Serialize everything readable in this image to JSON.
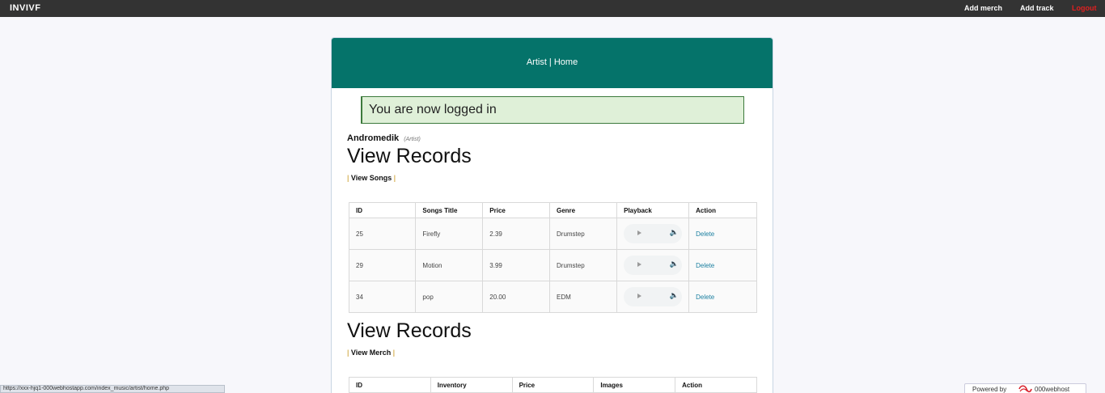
{
  "nav": {
    "brand": "INVIVF",
    "links": [
      "Add merch",
      "Add track",
      "Logout"
    ]
  },
  "panel": {
    "header": "Artist | Home",
    "alert": "You are now logged in",
    "artist_name": "Andromedik",
    "artist_role": "(Artist)"
  },
  "songs": {
    "heading": "View Records",
    "link_prefix": "|",
    "link_label": "View Songs",
    "link_suffix": "|",
    "columns": [
      "ID",
      "Songs Title",
      "Price",
      "Genre",
      "Playback",
      "Action"
    ],
    "rows": [
      {
        "id": "25",
        "title": "Firefly",
        "price": "2.39",
        "genre": "Drumstep",
        "action": "Delete"
      },
      {
        "id": "29",
        "title": "Motion",
        "price": "3.99",
        "genre": "Drumstep",
        "action": "Delete"
      },
      {
        "id": "34",
        "title": "pop",
        "price": "20.00",
        "genre": "EDM",
        "action": "Delete"
      }
    ]
  },
  "merch": {
    "heading": "View Records",
    "link_prefix": "|",
    "link_label": "View Merch",
    "link_suffix": "|",
    "columns": [
      "ID",
      "Inventory",
      "Price",
      "Images",
      "Action"
    ]
  },
  "statusbar": {
    "url": "https://xxx-hjq1-000webhostapp.com/index_music/artist/home.php"
  },
  "powered": {
    "label": "Powered by",
    "host": "000webhost"
  },
  "colors": {
    "topbar": "#333333",
    "header": "#05736a",
    "alert_bg": "#dff0d8",
    "logout": "#e02020",
    "link": "#1a7fa0"
  }
}
